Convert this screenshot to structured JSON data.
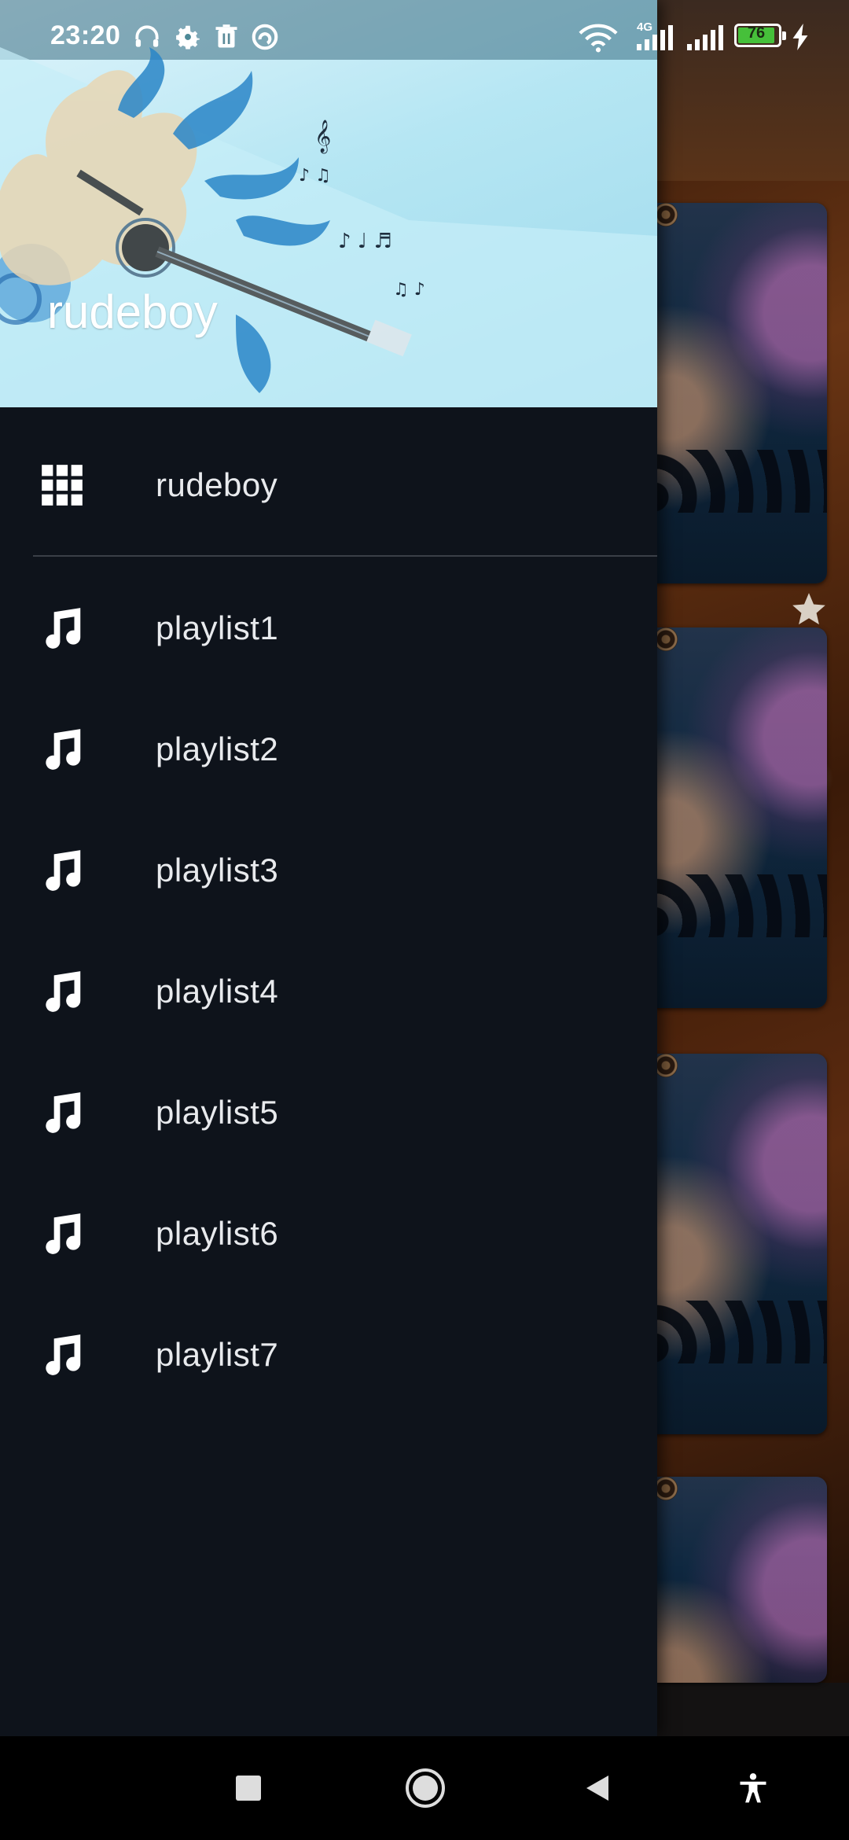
{
  "status_bar": {
    "time": "23:20",
    "network_label": "4G",
    "battery_level": "76",
    "icons": [
      "headphones-icon",
      "settings-icon",
      "trash-icon",
      "sync-icon",
      "wifi-icon",
      "signal-icon",
      "signal-icon",
      "battery-icon",
      "charging-icon"
    ]
  },
  "drawer": {
    "header_title": "rudeboy",
    "main_item": {
      "label": "rudeboy",
      "icon": "grid-icon"
    },
    "playlists": [
      {
        "label": "playlist1",
        "icon": "music-note-icon"
      },
      {
        "label": "playlist2",
        "icon": "music-note-icon"
      },
      {
        "label": "playlist3",
        "icon": "music-note-icon"
      },
      {
        "label": "playlist4",
        "icon": "music-note-icon"
      },
      {
        "label": "playlist5",
        "icon": "music-note-icon"
      },
      {
        "label": "playlist6",
        "icon": "music-note-icon"
      },
      {
        "label": "playlist7",
        "icon": "music-note-icon"
      }
    ]
  },
  "nav_bar": {
    "buttons": [
      "recents-button",
      "home-button",
      "back-button",
      "accessibility-button"
    ]
  },
  "colors": {
    "drawer_bg": "#0e131b",
    "header_bg": "#b5e6f3",
    "text": "#e8eaed",
    "battery_fill": "#46c03a"
  }
}
